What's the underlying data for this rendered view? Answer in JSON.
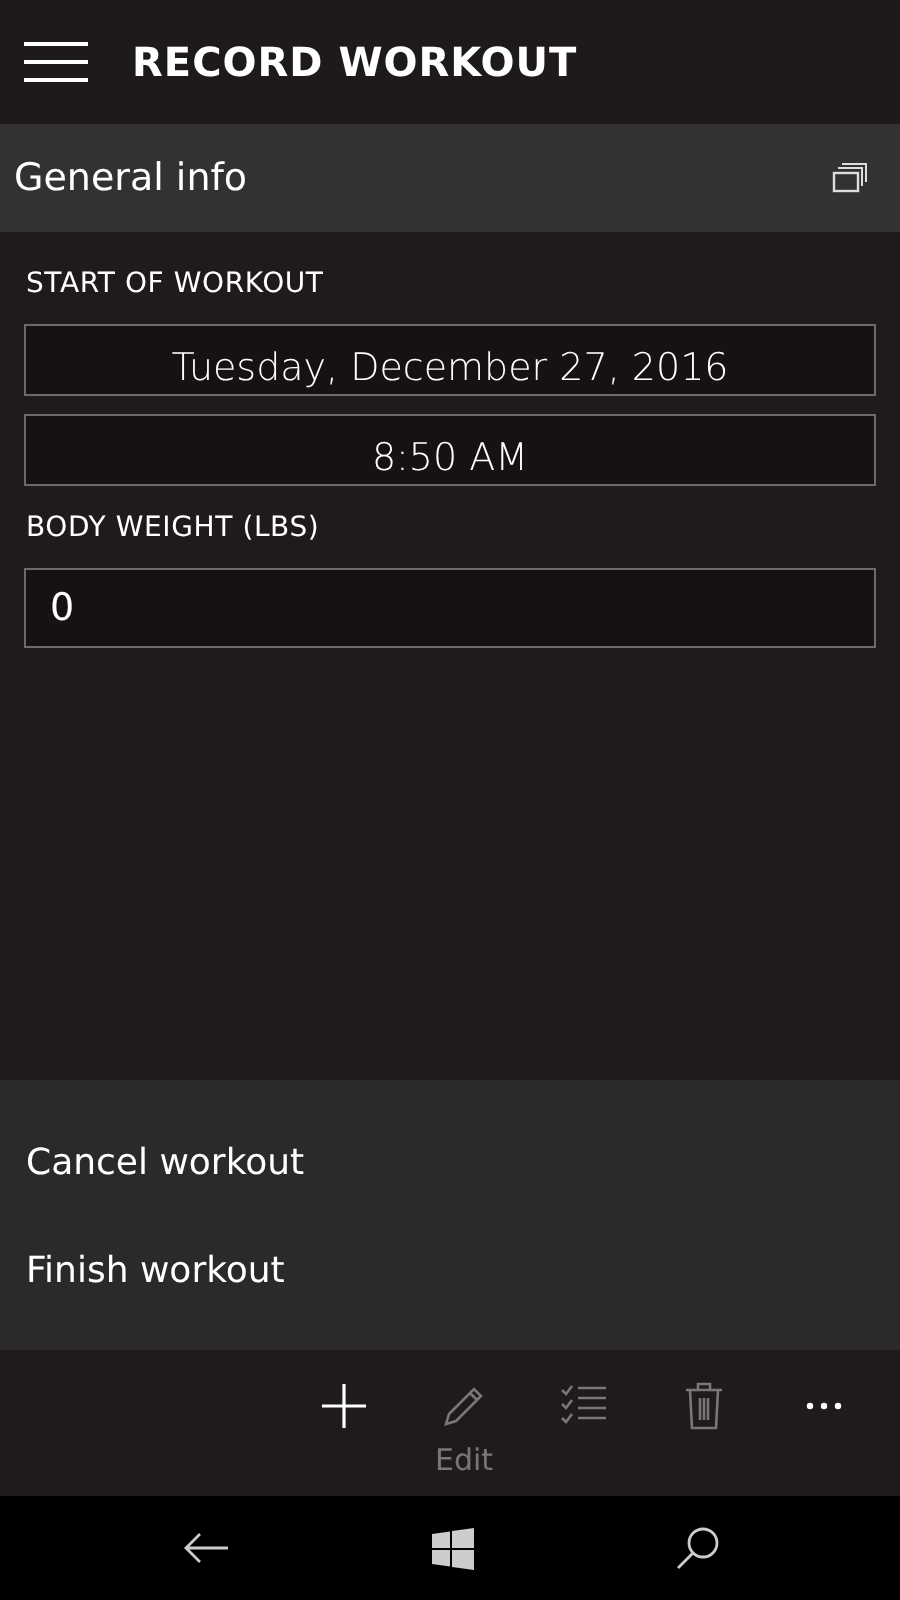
{
  "header": {
    "title": "RECORD WORKOUT"
  },
  "section": {
    "title": "General info"
  },
  "fields": [
    {
      "kind": "label",
      "text": "START OF WORKOUT"
    },
    {
      "kind": "picker",
      "value": "Tuesday, December 27, 2016"
    },
    {
      "kind": "picker",
      "value": "8:50 AM"
    },
    {
      "kind": "label",
      "text": "BODY WEIGHT (LBS)"
    },
    {
      "kind": "input",
      "value": "0"
    }
  ],
  "menu": [
    "Cancel workout",
    "Finish workout"
  ],
  "app_bar": [
    {
      "kind": "add",
      "disabled": false
    },
    {
      "kind": "edit",
      "label": "Edit",
      "disabled": true
    },
    {
      "kind": "select",
      "disabled": true
    },
    {
      "kind": "delete",
      "disabled": true
    },
    {
      "kind": "more",
      "disabled": false
    }
  ]
}
